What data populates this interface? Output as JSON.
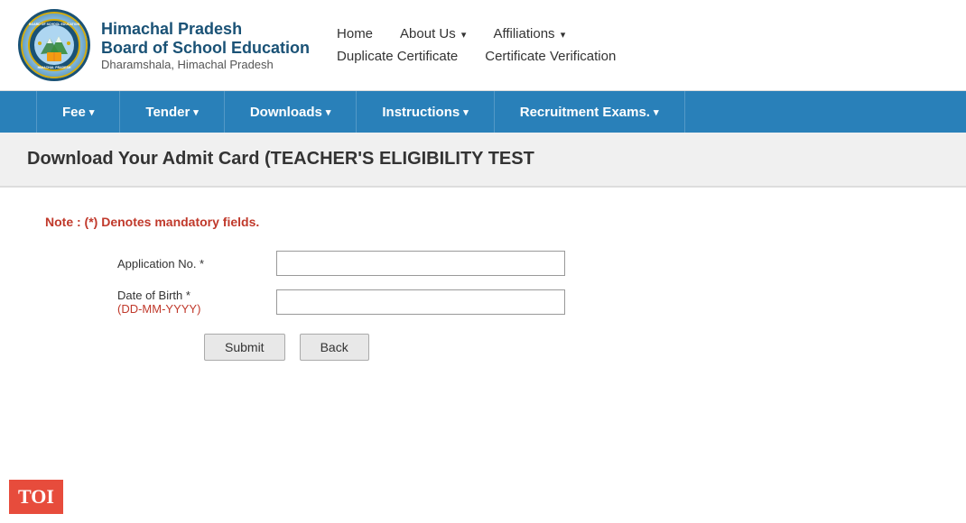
{
  "header": {
    "org_line1": "Himachal Pradesh",
    "org_line2": "Board of School Education",
    "org_line3": "Dharamshala, Himachal Pradesh"
  },
  "nav_top": {
    "row1": [
      {
        "label": "Home",
        "has_arrow": false
      },
      {
        "label": "About Us",
        "has_arrow": true
      },
      {
        "label": "Affiliations",
        "has_arrow": true
      }
    ],
    "row2": [
      {
        "label": "Duplicate Certificate",
        "has_arrow": false
      },
      {
        "label": "Certificate Verification",
        "has_arrow": false
      }
    ]
  },
  "blue_nav": {
    "items": [
      {
        "label": "Fee",
        "has_arrow": true
      },
      {
        "label": "Tender",
        "has_arrow": true
      },
      {
        "label": "Downloads",
        "has_arrow": true
      },
      {
        "label": "Instructions",
        "has_arrow": true
      },
      {
        "label": "Recruitment Exams.",
        "has_arrow": true
      }
    ]
  },
  "page": {
    "title": "Download Your Admit Card (TEACHER'S ELIGIBILITY TEST"
  },
  "form": {
    "note": "Note  : (*) Denotes mandatory fields.",
    "app_no_label": "Application No. *",
    "dob_label": "Date of Birth *",
    "dob_format": "(DD-MM-YYYY)",
    "app_no_placeholder": "",
    "dob_placeholder": "",
    "submit_label": "Submit",
    "back_label": "Back"
  },
  "toi": {
    "label": "TOI"
  }
}
